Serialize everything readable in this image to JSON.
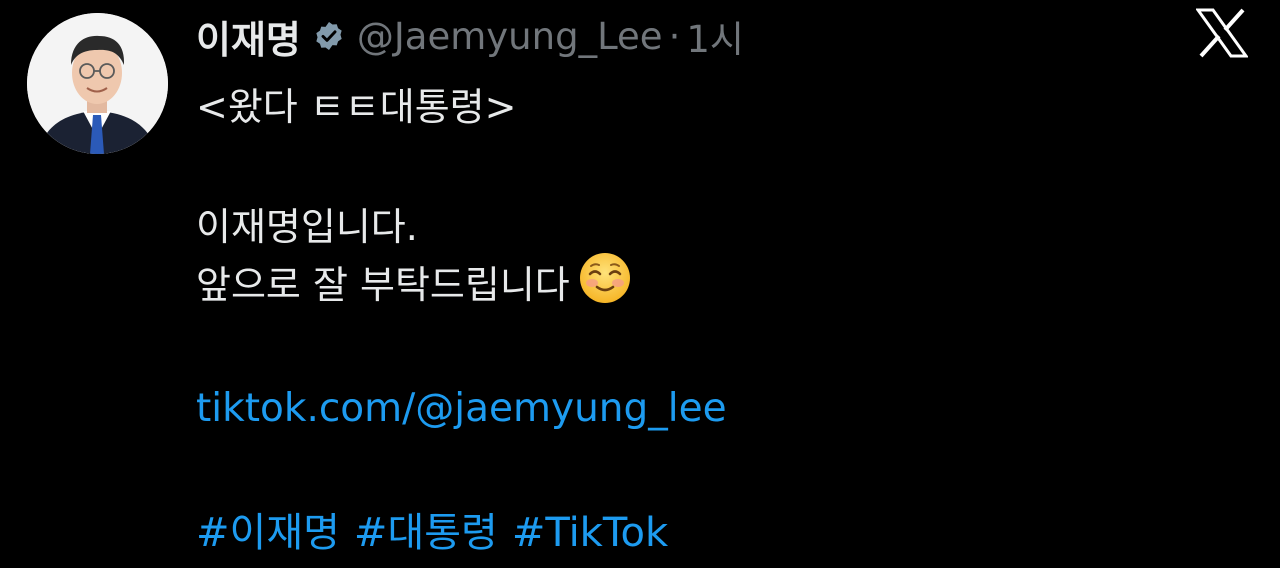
{
  "author": {
    "display_name": "이재명",
    "handle": "@Jaemyung_Lee",
    "separator": "·",
    "timestamp": "1시",
    "verified_color": "#829aab",
    "avatar_icon": "profile-photo"
  },
  "app": {
    "logo_icon": "x-logo-icon"
  },
  "tweet": {
    "line1": "<왔다 ㅌㅌ대통령>",
    "line2": "이재명입니다.",
    "line3": "앞으로 잘 부탁드립니다",
    "emoji": "smiling-face-emoji",
    "link": "tiktok.com/@jaemyung_lee",
    "hashtags": [
      "#이재명",
      "#대통령",
      "#TikTok"
    ]
  },
  "colors": {
    "background": "#000000",
    "text": "#e7e9ea",
    "secondary": "#71767b",
    "link": "#1d9bf0"
  }
}
